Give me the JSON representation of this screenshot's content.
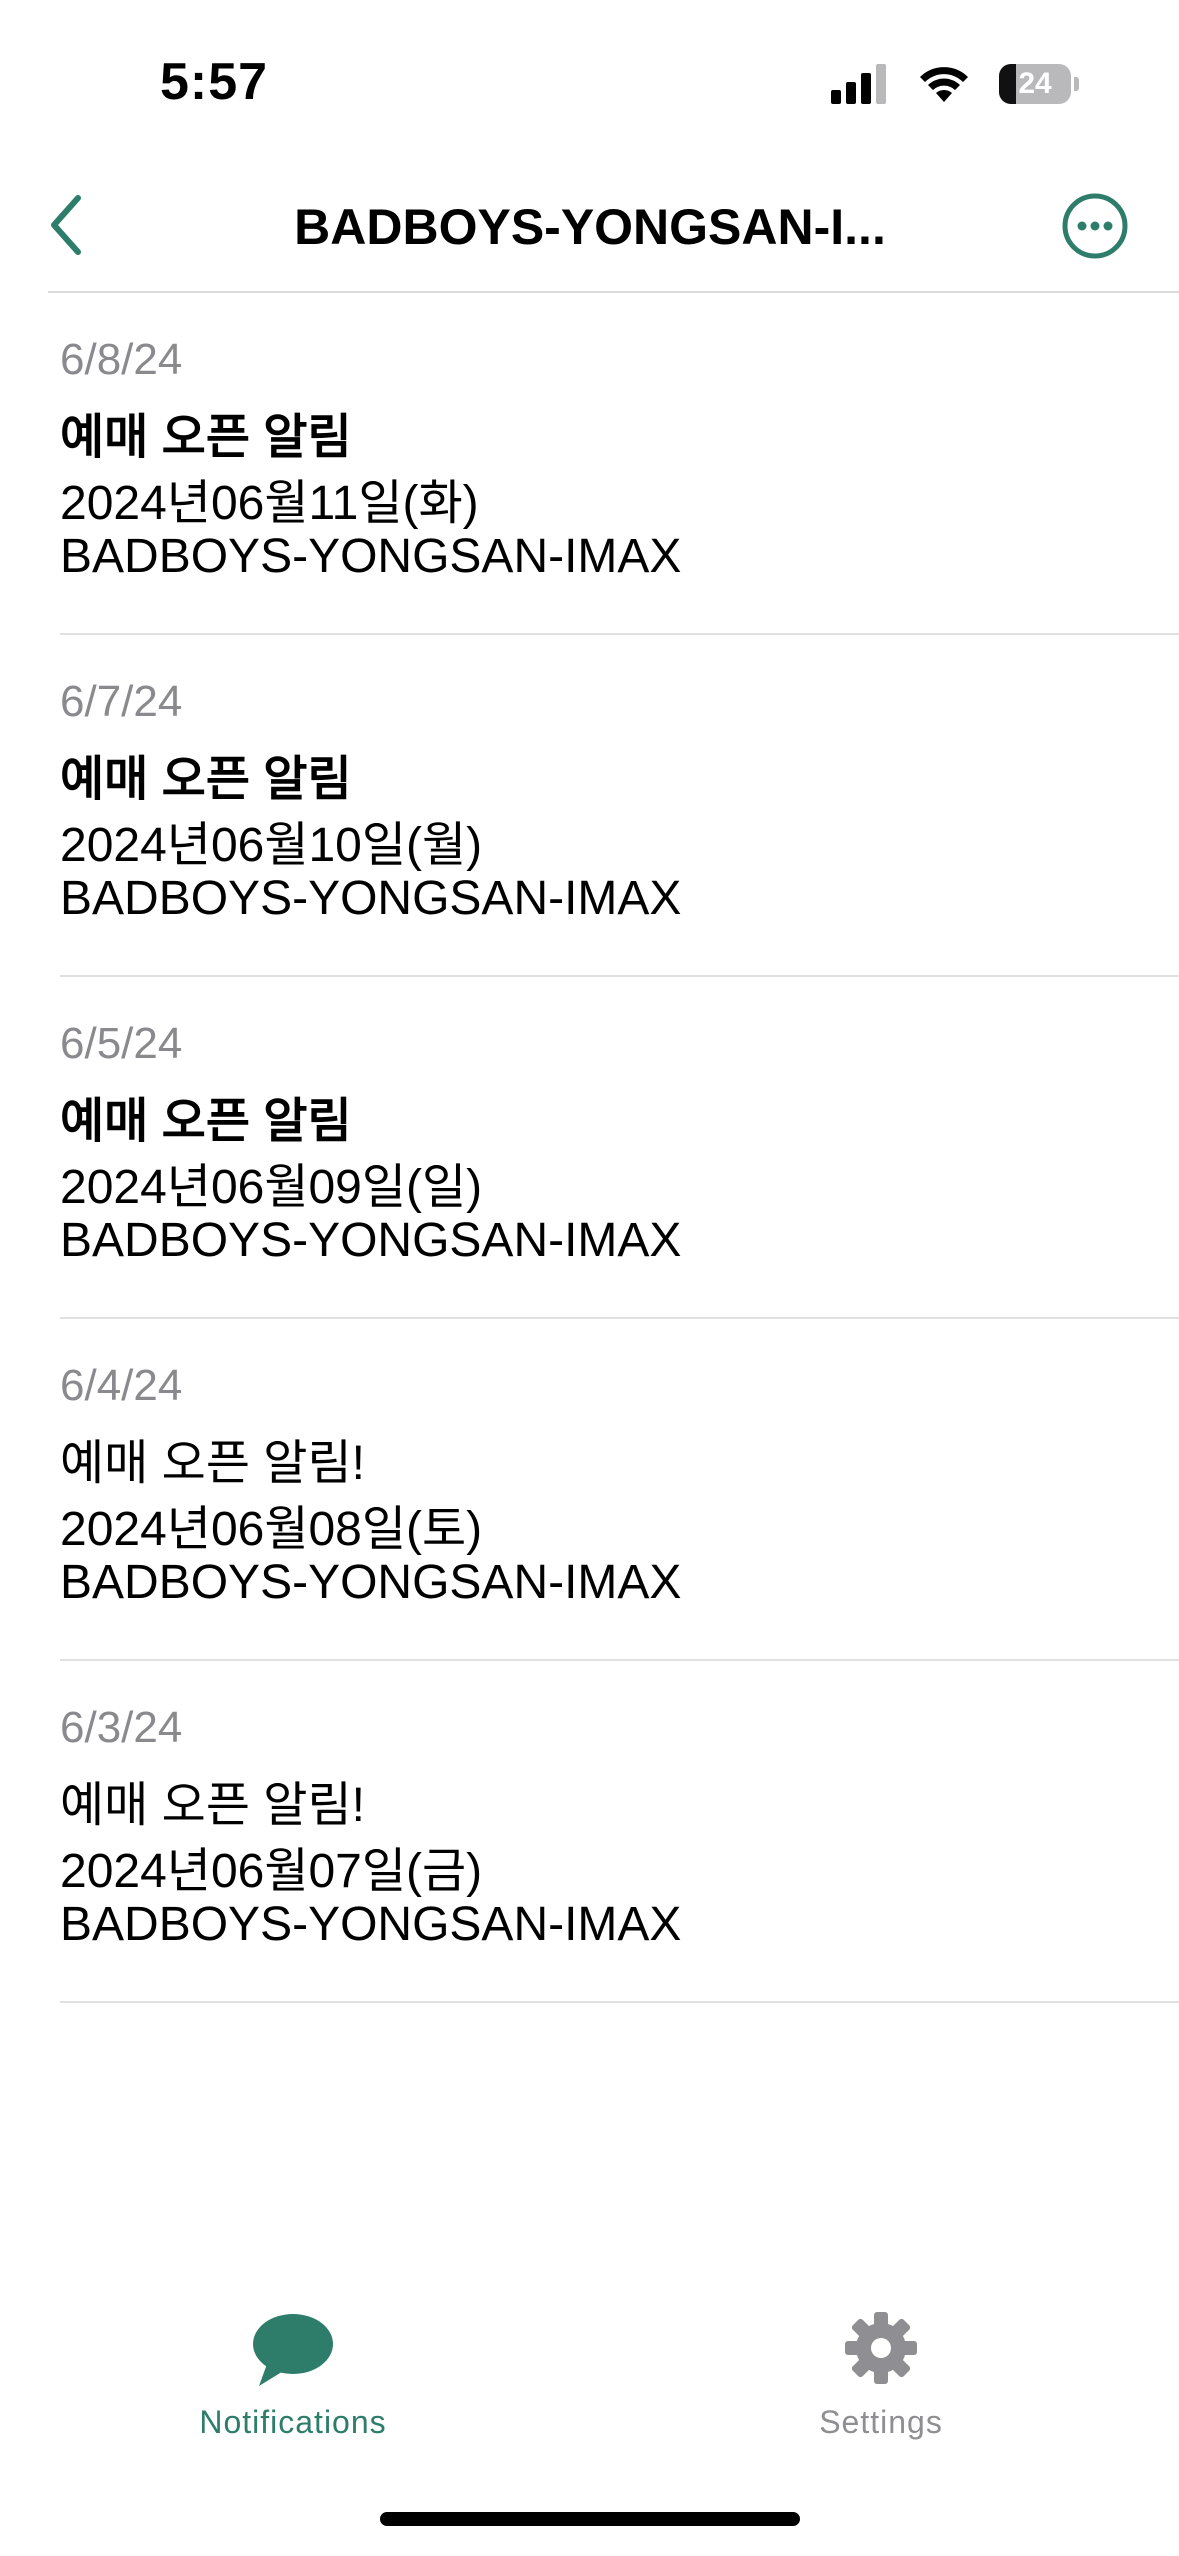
{
  "status_bar": {
    "time": "5:57",
    "battery_level": "24",
    "battery_fraction": 0.24
  },
  "nav": {
    "title": "BADBOYS-YONGSAN-I...",
    "back_icon": "chevron-left-icon",
    "more_icon": "ellipsis-circle-icon",
    "accent_color": "#2e7d6b"
  },
  "notifications": [
    {
      "date": "6/8/24",
      "title": "예매 오픈 알림",
      "line2": "2024년06월11일(화)",
      "line3": "BADBOYS-YONGSAN-IMAX",
      "bold": true
    },
    {
      "date": "6/7/24",
      "title": "예매 오픈 알림",
      "line2": "2024년06월10일(월)",
      "line3": "BADBOYS-YONGSAN-IMAX",
      "bold": true
    },
    {
      "date": "6/5/24",
      "title": "예매 오픈 알림",
      "line2": "2024년06월09일(일)",
      "line3": "BADBOYS-YONGSAN-IMAX",
      "bold": true
    },
    {
      "date": "6/4/24",
      "title": "예매 오픈 알림!",
      "line2": "2024년06월08일(토)",
      "line3": "BADBOYS-YONGSAN-IMAX",
      "bold": false
    },
    {
      "date": "6/3/24",
      "title": "예매 오픈 알림!",
      "line2": "2024년06월07일(금)",
      "line3": "BADBOYS-YONGSAN-IMAX",
      "bold": false
    }
  ],
  "tabs": {
    "notifications": {
      "label": "Notifications",
      "icon": "speech-bubble-icon",
      "active": true
    },
    "settings": {
      "label": "Settings",
      "icon": "gear-icon",
      "active": false
    }
  },
  "colors": {
    "accent": "#2e7d6b",
    "inactive": "#8e8e93",
    "date_gray": "#8a8a8e"
  }
}
